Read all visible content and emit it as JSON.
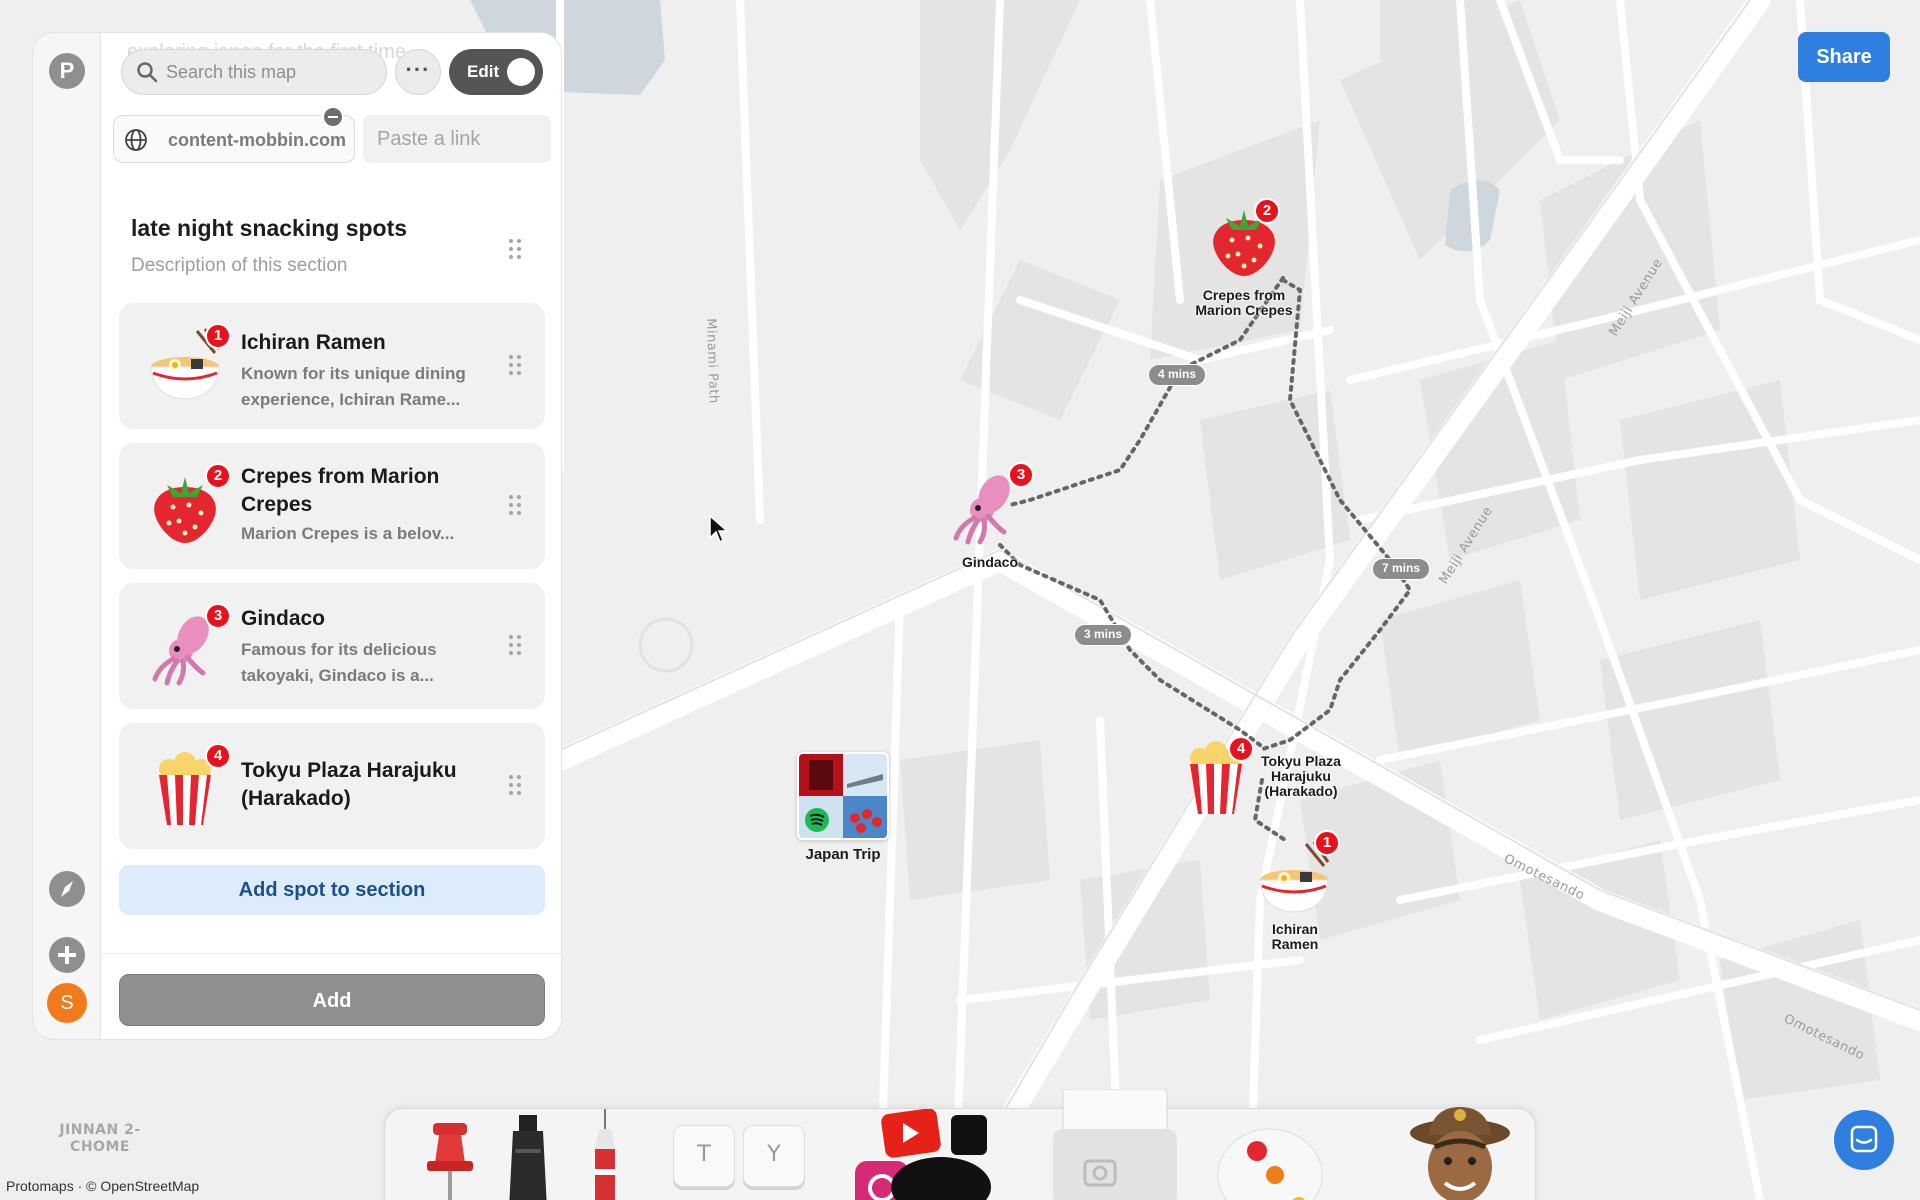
{
  "app": {
    "logo_letter": "P",
    "user_initial": "S",
    "share_label": "Share"
  },
  "panel": {
    "ghost_title": "exploring japan for the first time",
    "search_placeholder": "Search this map",
    "more_label": "···",
    "edit_label": "Edit",
    "link_chip": "content-mobbin.com",
    "paste_placeholder": "Paste a link",
    "section_title": "late night snacking spots",
    "section_description": "Description of this section",
    "spots": [
      {
        "number": "1",
        "title": "Ichiran Ramen",
        "description": "Known for its unique dining experience, Ichiran Rame...",
        "icon": "ramen-icon"
      },
      {
        "number": "2",
        "title": "Crepes from Marion Crepes",
        "description": "Marion Crepes is a belov...",
        "icon": "strawberry-icon"
      },
      {
        "number": "3",
        "title": "Gindaco",
        "description": "Famous for its delicious takoyaki, Gindaco is a...",
        "icon": "squid-icon"
      },
      {
        "number": "4",
        "title": "Tokyu Plaza Harajuku (Harakado)",
        "description": "",
        "icon": "popcorn-icon"
      }
    ],
    "add_spot_label": "Add spot to section",
    "add_label": "Add"
  },
  "map": {
    "pins": [
      {
        "number": "2",
        "label": "Crepes from Marion Crepes",
        "icon": "strawberry-icon"
      },
      {
        "number": "3",
        "label": "Gindaco",
        "icon": "squid-icon"
      },
      {
        "number": "4",
        "label": "Tokyu Plaza Harajuku (Harakado)",
        "icon": "popcorn-icon"
      },
      {
        "number": "1",
        "label": "Ichiran Ramen",
        "icon": "ramen-icon"
      }
    ],
    "travel_times": [
      "4 mins",
      "3 mins",
      "7 mins"
    ],
    "japan_trip_label": "Japan Trip",
    "street_labels": {
      "minami_path": "Minami Path",
      "meiji_avenue_1": "Meiji Avenue",
      "meiji_avenue_2": "Meiji Avenue",
      "omotesando_1": "Omotesando",
      "omotesando_2": "Omotesando",
      "district": "JINNAN 2-CHOME"
    },
    "attribution": "Protomaps · © OpenStreetMap"
  },
  "dock": {
    "key_t": "T",
    "key_y": "Y"
  },
  "colors": {
    "accent": "#2f7fe0",
    "badge": "#e8121d",
    "route": "#666666"
  }
}
